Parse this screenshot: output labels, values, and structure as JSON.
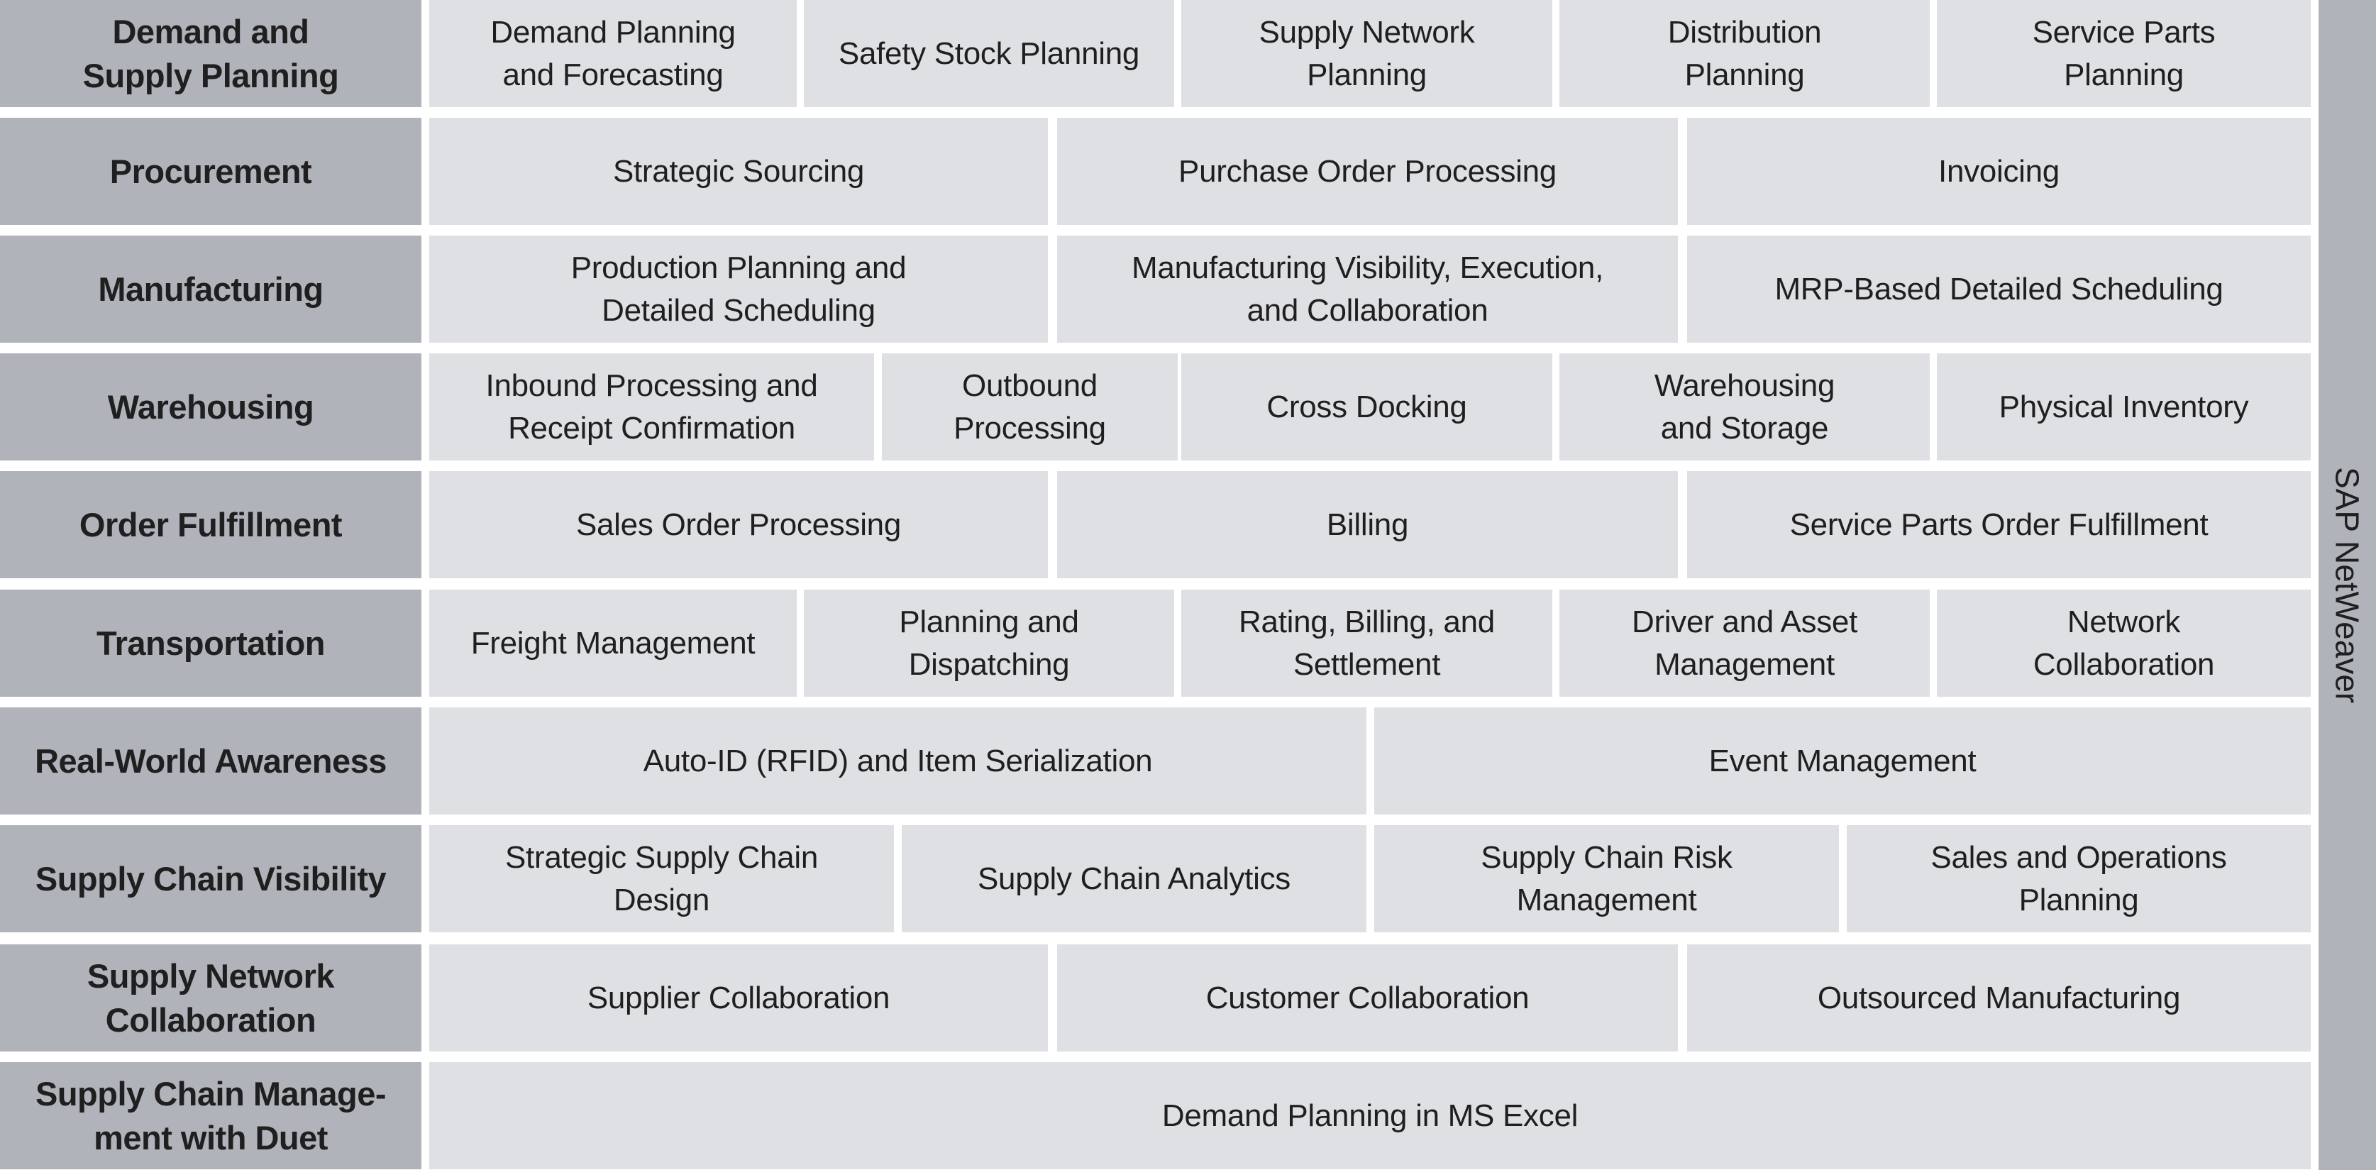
{
  "platform_label": "SAP NetWeaver",
  "colors": {
    "row_header_bg": "#b0b3ba",
    "cell_bg": "#dfe0e4",
    "text": "#1f1f1f",
    "background": "#ffffff"
  },
  "rows": [
    {
      "header": "Demand and\nSupply Planning",
      "cells": [
        "Demand Planning\nand Forecasting",
        "Safety Stock Planning",
        "Supply Network\nPlanning",
        "Distribution\nPlanning",
        "Service Parts\nPlanning"
      ]
    },
    {
      "header": "Procurement",
      "cells": [
        "Strategic Sourcing",
        "Purchase Order Processing",
        "Invoicing"
      ]
    },
    {
      "header": "Manufacturing",
      "cells": [
        "Production Planning and\nDetailed Scheduling",
        "Manufacturing Visibility, Execution,\nand Collaboration",
        "MRP-Based Detailed Scheduling"
      ]
    },
    {
      "header": "Warehousing",
      "cells": [
        "Inbound Processing and\nReceipt Confirmation",
        "Outbound\nProcessing",
        "Cross Docking",
        "Warehousing\nand Storage",
        "Physical Inventory"
      ]
    },
    {
      "header": "Order Fulfillment",
      "cells": [
        "Sales Order Processing",
        "Billing",
        "Service Parts Order Fulfillment"
      ]
    },
    {
      "header": "Transportation",
      "cells": [
        "Freight Management",
        "Planning and\nDispatching",
        "Rating, Billing, and\nSettlement",
        "Driver and Asset\nManagement",
        "Network\nCollaboration"
      ]
    },
    {
      "header": "Real-World Awareness",
      "cells": [
        "Auto-ID (RFID) and Item Serialization",
        "Event Management"
      ]
    },
    {
      "header": "Supply Chain Visibility",
      "cells": [
        "Strategic Supply Chain\nDesign",
        "Supply Chain Analytics",
        "Supply Chain Risk\nManagement",
        "Sales and Operations\nPlanning"
      ]
    },
    {
      "header": "Supply Network\nCollaboration",
      "cells": [
        "Supplier Collaboration",
        "Customer Collaboration",
        "Outsourced Manufacturing"
      ]
    },
    {
      "header": "Supply Chain Manage-\nment with Duet",
      "cells": [
        "Demand Planning in MS Excel"
      ]
    }
  ]
}
